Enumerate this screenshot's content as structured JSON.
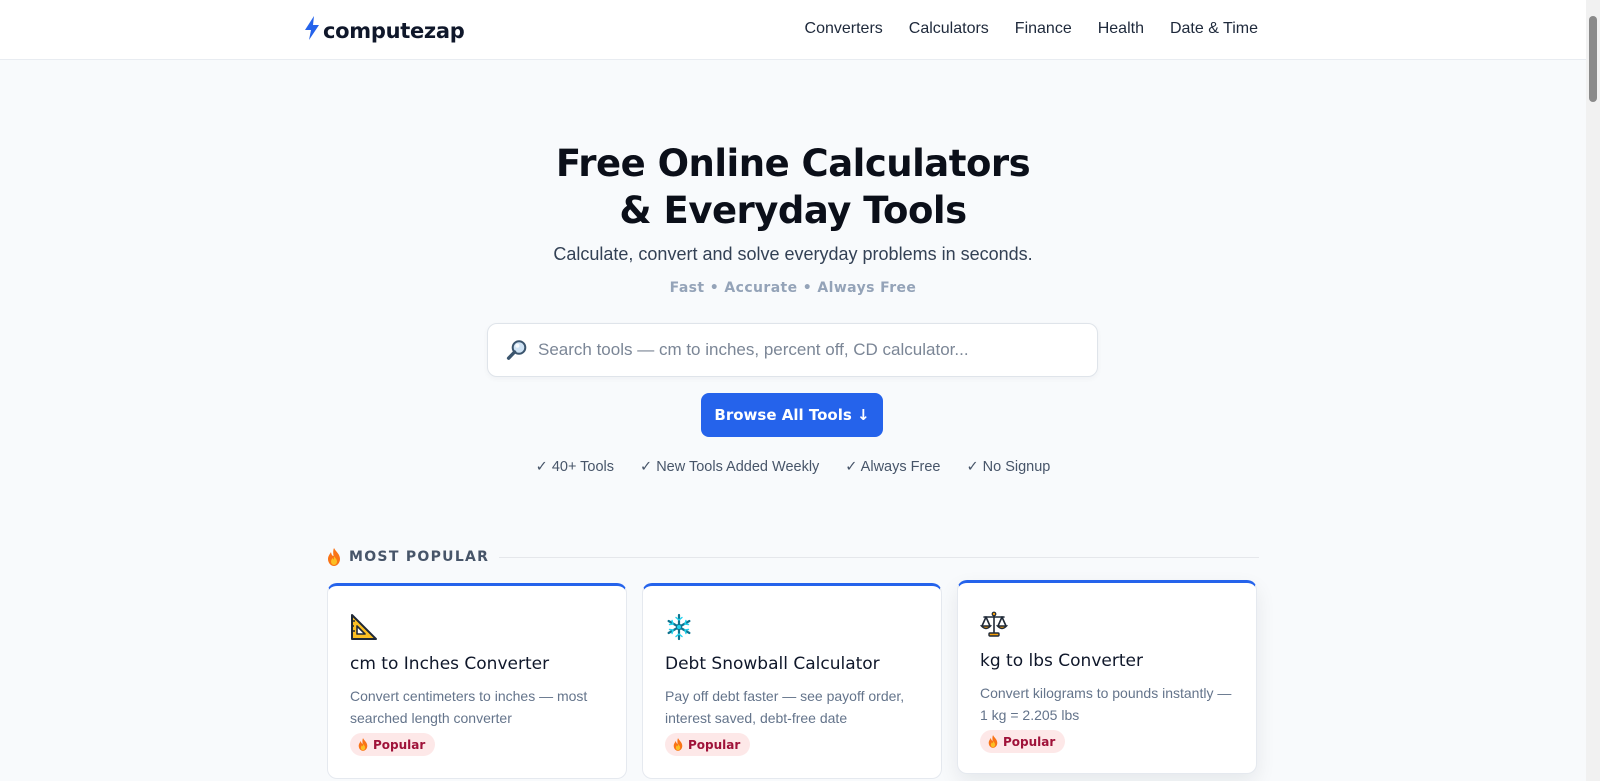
{
  "header": {
    "logo_light": "compute",
    "logo_bold": "zap",
    "nav": [
      "Converters",
      "Calculators",
      "Finance",
      "Health",
      "Date & Time"
    ]
  },
  "hero": {
    "title_line1": "Free Online Calculators",
    "title_line2": "& Everyday Tools",
    "subtitle": "Calculate, convert and solve everyday problems in seconds.",
    "tagline": "Fast • Accurate • Always Free",
    "search_placeholder": "Search tools — cm to inches, percent off, CD calculator...",
    "browse_label": "Browse All Tools ↓",
    "features": [
      "✓ 40+ Tools",
      "✓ New Tools Added Weekly",
      "✓ Always Free",
      "✓ No Signup"
    ]
  },
  "popular": {
    "section_title": "MOST POPULAR",
    "cards": [
      {
        "icon": "triangular-ruler-icon",
        "title": "cm to Inches Converter",
        "desc": "Convert centimeters to inches — most searched length converter",
        "badge": "Popular"
      },
      {
        "icon": "snowflake-icon",
        "title": "Debt Snowball Calculator",
        "desc": "Pay off debt faster — see payoff order, interest saved, debt-free date",
        "badge": "Popular"
      },
      {
        "icon": "balance-scale-icon",
        "title": "kg to lbs Converter",
        "desc": "Convert kilograms to pounds instantly — 1 kg = 2.205 lbs",
        "badge": "Popular"
      }
    ]
  },
  "colors": {
    "accent": "#2563eb",
    "badge_bg": "#fde8e8",
    "badge_text": "#9f1239"
  }
}
